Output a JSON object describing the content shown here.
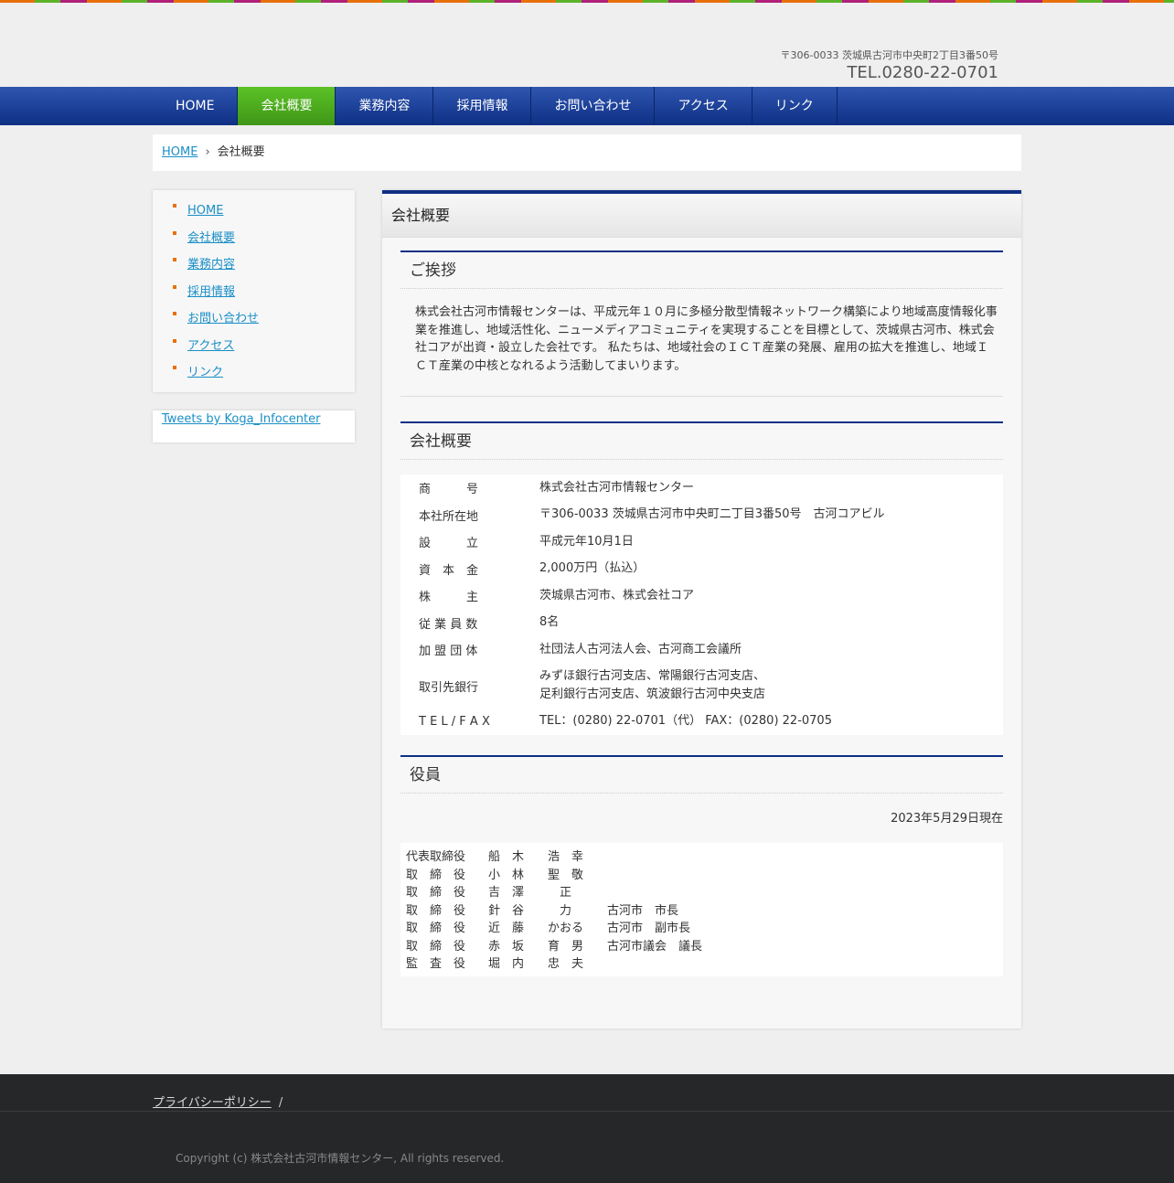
{
  "header": {
    "address": "〒306-0033 茨城県古河市中央町2丁目3番50号",
    "tel": "TEL.0280-22-0701"
  },
  "nav": {
    "items": [
      {
        "label": "HOME"
      },
      {
        "label": "会社概要"
      },
      {
        "label": "業務内容"
      },
      {
        "label": "採用情報"
      },
      {
        "label": "お問い合わせ"
      },
      {
        "label": "アクセス"
      },
      {
        "label": "リンク"
      }
    ],
    "active": "会社概要"
  },
  "breadcrumb": {
    "home": "HOME",
    "separator": "›",
    "current": "会社概要"
  },
  "sidebar": {
    "items": [
      {
        "label": "HOME"
      },
      {
        "label": "会社概要"
      },
      {
        "label": "業務内容"
      },
      {
        "label": "採用情報"
      },
      {
        "label": "お問い合わせ"
      },
      {
        "label": "アクセス"
      },
      {
        "label": "リンク"
      }
    ],
    "tweets_link": "Tweets by Koga_Infocenter"
  },
  "main": {
    "title": "会社概要",
    "greeting": {
      "heading": "ご挨拶",
      "body": "株式会社古河市情報センターは、平成元年１０月に多極分散型情報ネットワーク構築により地域高度情報化事業を推進し、地域活性化、ニューメディアコミュニティを実現することを目標として、茨城県古河市、株式会社コアが出資・設立した会社です。 私たちは、地域社会のＩＣＴ産業の発展、雇用の拡大を推進し、地域ＩＣＴ産業の中核となれるよう活動してまいります。"
    },
    "overview": {
      "heading": "会社概要",
      "rows": [
        {
          "label": "商　　　号",
          "value": "株式会社古河市情報センター"
        },
        {
          "label": "本社所在地",
          "value": "〒306-0033 茨城県古河市中央町二丁目3番50号　古河コアビル"
        },
        {
          "label": "設　　　立",
          "value": "平成元年10月1日"
        },
        {
          "label": "資　本　金",
          "value": "2,000万円（払込）"
        },
        {
          "label": "株　　　主",
          "value": "茨城県古河市、株式会社コア"
        },
        {
          "label": "従 業 員 数",
          "value": "8名"
        },
        {
          "label": "加 盟 団 体",
          "value": "社団法人古河法人会、古河商工会議所"
        },
        {
          "label": "取引先銀行",
          "value": "みずほ銀行古河支店、常陽銀行古河支店、\n足利銀行古河支店、筑波銀行古河中央支店"
        },
        {
          "label": "T E L / F A X",
          "value": "TEL：(0280) 22-0701（代）  FAX：(0280) 22-0705"
        }
      ]
    },
    "officers": {
      "heading": "役員",
      "as_of": "2023年5月29日現在",
      "rows": [
        {
          "title": "代表取締役",
          "name": "船　木　　浩　幸",
          "post": ""
        },
        {
          "title": "取　締　役",
          "name": "小　林　　聖　敬",
          "post": ""
        },
        {
          "title": "取　締　役",
          "name": "吉　澤　　　正",
          "post": ""
        },
        {
          "title": "取　締　役",
          "name": "針　谷　　　力",
          "post": "古河市　市長"
        },
        {
          "title": "取　締　役",
          "name": "近　藤　　かおる",
          "post": "古河市　副市長"
        },
        {
          "title": "取　締　役",
          "name": "赤　坂　　育　男",
          "post": "古河市議会　議長"
        },
        {
          "title": "監　査　役",
          "name": "堀　内　　忠　夫",
          "post": ""
        }
      ]
    }
  },
  "footer": {
    "privacy": "プライバシーポリシー",
    "slash": "/",
    "copyright": "Copyright (c) 株式会社古河市情報センター, All rights reserved."
  },
  "colors": {
    "nav_blue": "#0e2f84",
    "nav_active_green": "#4faa1f",
    "link_blue": "#1a8fc7",
    "bullet_orange": "#e8700a"
  }
}
